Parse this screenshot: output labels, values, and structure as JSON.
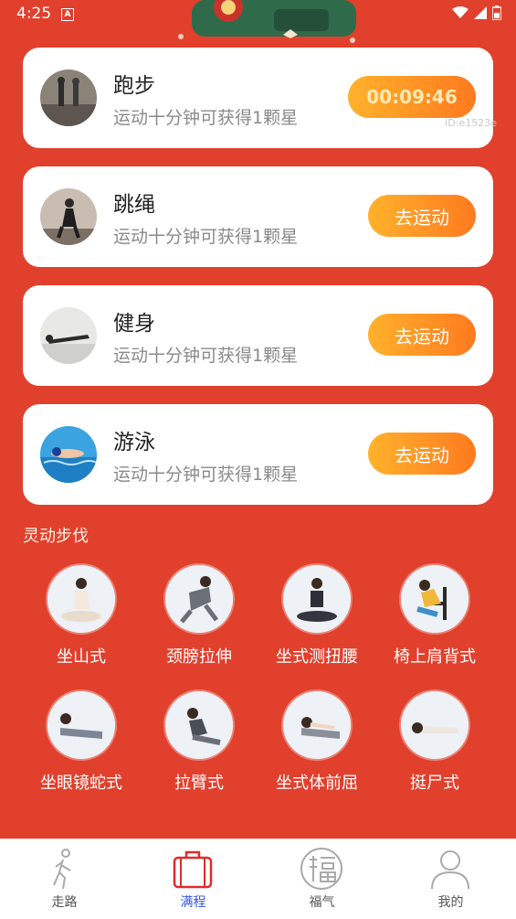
{
  "status": {
    "time": "4:25",
    "indicator": "A"
  },
  "cards": [
    {
      "title": "跑步",
      "subtitle": "运动十分钟可获得1颗星",
      "button": "00:09:46",
      "id_text": "ID:e1523e"
    },
    {
      "title": "跳绳",
      "subtitle": "运动十分钟可获得1颗星",
      "button": "去运动"
    },
    {
      "title": "健身",
      "subtitle": "运动十分钟可获得1颗星",
      "button": "去运动"
    },
    {
      "title": "游泳",
      "subtitle": "运动十分钟可获得1颗星",
      "button": "去运动"
    }
  ],
  "section_title": "灵动步伐",
  "poses": [
    "坐山式",
    "颈膀拉伸",
    "坐式测扭腰",
    "椅上肩背式",
    "坐眼镜蛇式",
    "拉臂式",
    "坐式体前屈",
    "挺尸式"
  ],
  "tabs": [
    {
      "label": "走路",
      "icon": "walking-person-icon",
      "active": false
    },
    {
      "label": "满程",
      "icon": "briefcase-icon",
      "active": true
    },
    {
      "label": "福气",
      "icon": "fu-character-icon",
      "active": false
    },
    {
      "label": "我的",
      "icon": "user-profile-icon",
      "active": false
    }
  ],
  "colors": {
    "background": "#e0402c",
    "button_start": "#ffb22c",
    "button_end": "#ff7a1f",
    "active_tab": "#2f54eb",
    "timer_active_bg": "#e02b2b"
  }
}
